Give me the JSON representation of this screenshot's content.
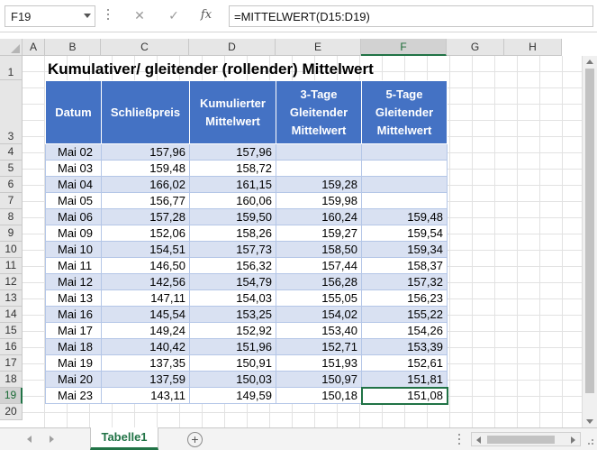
{
  "formula_bar": {
    "name_box": "F19",
    "cancel_glyph": "✕",
    "enter_glyph": "✓",
    "function_glyph": "fx",
    "formula": "=MITTELWERT(D15:D19)"
  },
  "columns": [
    "A",
    "B",
    "C",
    "D",
    "E",
    "F",
    "G",
    "H"
  ],
  "active_column": "F",
  "rows": [
    "1",
    "3",
    "4",
    "5",
    "6",
    "7",
    "8",
    "9",
    "10",
    "11",
    "12",
    "13",
    "14",
    "15",
    "16",
    "17",
    "18",
    "19",
    "20"
  ],
  "active_row": "19",
  "sheet": {
    "title": "Kumulativer/ gleitender (rollender) Mittelwert",
    "headers": {
      "date": "Datum",
      "close": "Schließpreis",
      "cumulative_1": "Kumulierter",
      "cumulative_2": "Mittelwert",
      "ma3_1": "3-Tage",
      "ma3_2": "Gleitender",
      "ma3_3": "Mittelwert",
      "ma5_1": "5-Tage",
      "ma5_2": "Gleitender",
      "ma5_3": "Mittelwert"
    },
    "data": [
      [
        "Mai 02",
        "157,96",
        "157,96",
        "",
        ""
      ],
      [
        "Mai 03",
        "159,48",
        "158,72",
        "",
        ""
      ],
      [
        "Mai 04",
        "166,02",
        "161,15",
        "159,28",
        ""
      ],
      [
        "Mai 05",
        "156,77",
        "160,06",
        "159,98",
        ""
      ],
      [
        "Mai 06",
        "157,28",
        "159,50",
        "160,24",
        "159,48"
      ],
      [
        "Mai 09",
        "152,06",
        "158,26",
        "159,27",
        "159,54"
      ],
      [
        "Mai 10",
        "154,51",
        "157,73",
        "158,50",
        "159,34"
      ],
      [
        "Mai 11",
        "146,50",
        "156,32",
        "157,44",
        "158,37"
      ],
      [
        "Mai 12",
        "142,56",
        "154,79",
        "156,28",
        "157,32"
      ],
      [
        "Mai 13",
        "147,11",
        "154,03",
        "155,05",
        "156,23"
      ],
      [
        "Mai 16",
        "145,54",
        "153,25",
        "154,02",
        "155,22"
      ],
      [
        "Mai 17",
        "149,24",
        "152,92",
        "153,40",
        "154,26"
      ],
      [
        "Mai 18",
        "140,42",
        "151,96",
        "152,71",
        "153,39"
      ],
      [
        "Mai 19",
        "137,35",
        "150,91",
        "151,93",
        "152,61"
      ],
      [
        "Mai 20",
        "137,59",
        "150,03",
        "150,97",
        "151,81"
      ],
      [
        "Mai 23",
        "143,11",
        "149,59",
        "150,18",
        "151,08"
      ]
    ]
  },
  "sheet_tabs": {
    "active_tab": "Tabelle1",
    "add_glyph": "+"
  },
  "colors": {
    "header_fill": "#4472c4",
    "band_fill": "#d9e1f2",
    "selection": "#217346"
  }
}
